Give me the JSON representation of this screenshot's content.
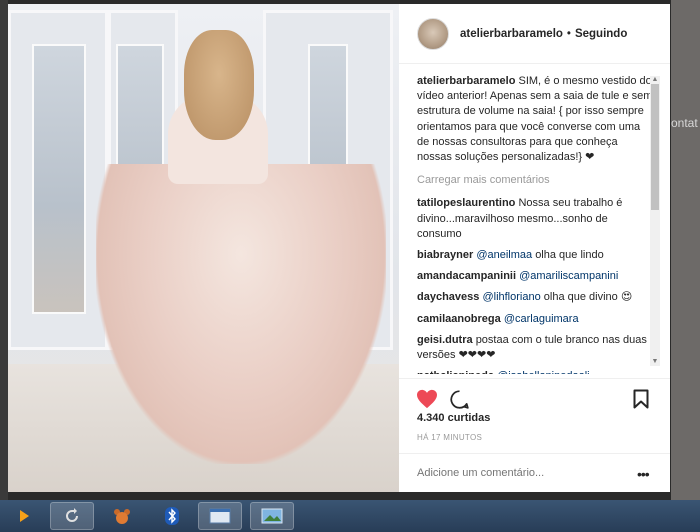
{
  "header": {
    "username": "atelierbarbaramelo",
    "separator": "•",
    "follow_status": "Seguindo"
  },
  "background": {
    "right_text": "ontat"
  },
  "caption": {
    "username": "atelierbarbaramelo",
    "text": "SIM, é o mesmo vestido do vídeo anterior! Apenas sem a saia de tule e sem estrutura de volume na saia! { por isso sempre orientamos para que você converse com uma de nossas consultoras para que conheça nossas soluções personalizadas!} ❤"
  },
  "load_more": "Carregar mais comentários",
  "comments": [
    {
      "username": "tatilopeslaurentino",
      "mention": "",
      "text": "Nossa seu trabalho é divino...maravilhoso mesmo...sonho de consumo"
    },
    {
      "username": "biabrayner",
      "mention": "@aneilmaa",
      "text": "olha que lindo"
    },
    {
      "username": "amandacampaninii",
      "mention": "@amariliscampanini",
      "text": ""
    },
    {
      "username": "daychavess",
      "mention": "@lihfloriano",
      "text": "olha que divino 😍"
    },
    {
      "username": "camilaanobrega",
      "mention": "@carlaguimara",
      "text": ""
    },
    {
      "username": "geisi.dutra",
      "mention": "",
      "text": "postaa com o tule branco nas duas versões ❤❤❤❤"
    },
    {
      "username": "nathaliapineda",
      "mention": "@isabellapinedaoli",
      "text": ""
    }
  ],
  "actions": {
    "like_icon": "heart-icon",
    "comment_icon": "comment-icon",
    "save_icon": "bookmark-icon",
    "like_color": "#ed4956"
  },
  "likes": "4.340 curtidas",
  "timestamp": "HÁ 17 MINUTOS",
  "add_comment": {
    "placeholder": "Adicione um comentário...",
    "more_icon": "more-icon"
  },
  "taskbar": {
    "items": [
      {
        "name": "vlc-icon"
      },
      {
        "name": "refresh-app-icon"
      },
      {
        "name": "bear-app-icon"
      },
      {
        "name": "bluetooth-icon"
      },
      {
        "name": "window-app-icon"
      },
      {
        "name": "image-viewer-icon"
      }
    ]
  }
}
